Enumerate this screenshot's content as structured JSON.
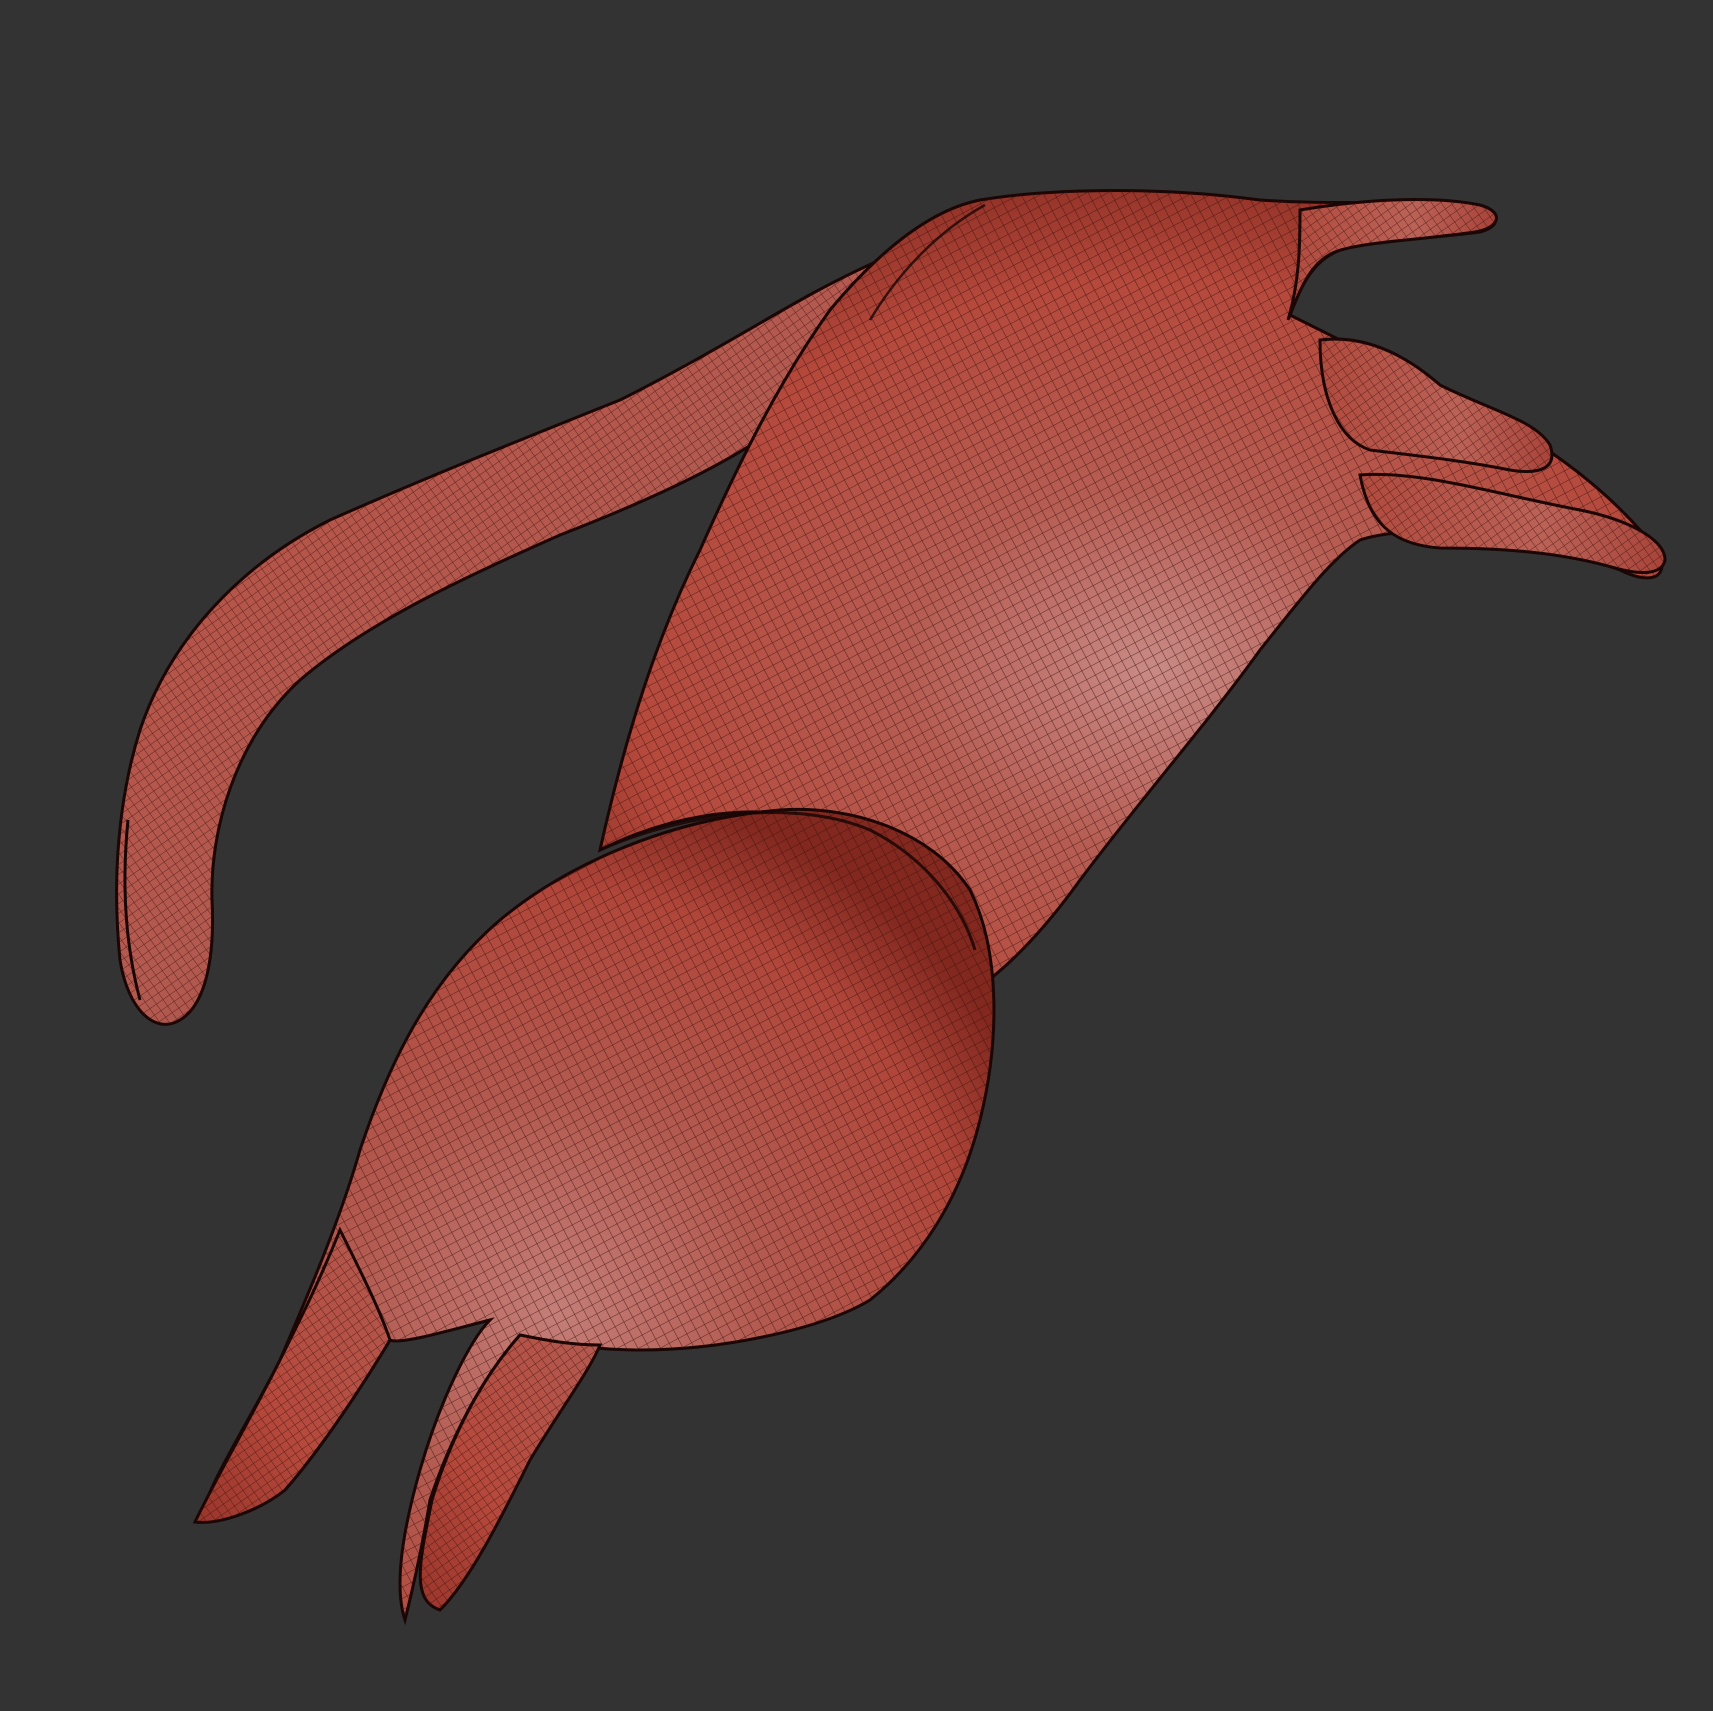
{
  "scene": {
    "background_color": "#333333",
    "mesh_base_color": "#b5493c",
    "mesh_highlight_color": "#c98a86",
    "mesh_shadow_color": "#6b1e17",
    "wire_color": "#3a0e0a",
    "outline_color": "#1a0605",
    "parts": [
      {
        "name": "upper-body-torso-mesh"
      },
      {
        "name": "long-curved-tail-mesh"
      },
      {
        "name": "top-claw-finger-mesh"
      },
      {
        "name": "middle-claw-finger-mesh"
      },
      {
        "name": "lower-claw-finger-mesh"
      },
      {
        "name": "lower-body-mesh"
      },
      {
        "name": "left-spike-leg-mesh"
      },
      {
        "name": "right-spike-leg-mesh"
      }
    ]
  }
}
